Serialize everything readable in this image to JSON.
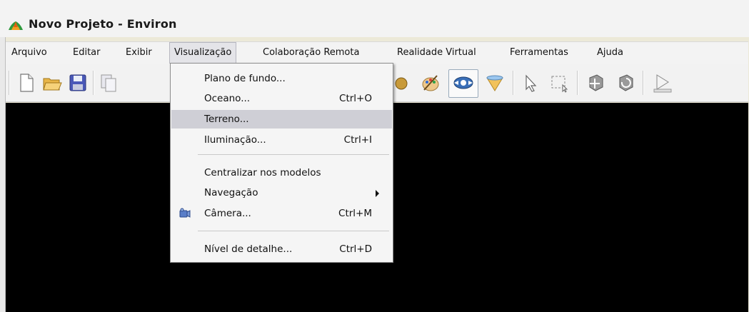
{
  "window": {
    "title": "Novo Projeto - Environ"
  },
  "menubar": {
    "items": [
      {
        "label": "Arquivo"
      },
      {
        "label": "Editar"
      },
      {
        "label": "Exibir"
      },
      {
        "label": "Visualização",
        "active": true
      },
      {
        "label": "Colaboração Remota"
      },
      {
        "label": "Realidade Virtual"
      },
      {
        "label": "Ferramentas"
      },
      {
        "label": "Ajuda"
      }
    ]
  },
  "toolbar": {
    "icons": [
      "new-file-icon",
      "open-folder-icon",
      "save-icon",
      "copy-icon",
      "globe-icon",
      "paint-palette-icon",
      "navigation-eye-icon",
      "cone-filter-icon",
      "select-arrow-icon",
      "marquee-select-icon",
      "move-object-icon",
      "rotate-object-icon",
      "play-ruler-icon"
    ]
  },
  "dropdown": {
    "items": [
      {
        "label": "Plano de fundo...",
        "shortcut": ""
      },
      {
        "label": "Oceano...",
        "shortcut": "Ctrl+O"
      },
      {
        "label": "Terreno...",
        "shortcut": "",
        "highlighted": true
      },
      {
        "label": "Iluminação...",
        "shortcut": "Ctrl+I"
      },
      {
        "label": "Centralizar nos modelos",
        "shortcut": ""
      },
      {
        "label": "Navegação",
        "shortcut": "",
        "submenu": true
      },
      {
        "label": "Câmera...",
        "shortcut": "Ctrl+M",
        "icon": "camera-icon"
      },
      {
        "label": "Nível de detalhe...",
        "shortcut": "Ctrl+D"
      }
    ]
  },
  "colors": {
    "viewport": "#000000",
    "menu_highlight": "#cfcfd6",
    "menubar_bg": "#f3f3f3"
  }
}
